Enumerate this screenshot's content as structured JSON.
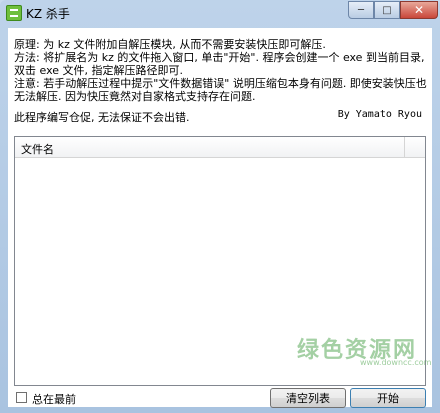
{
  "window": {
    "title": "KZ 杀手",
    "minimize": "─",
    "maximize": "□",
    "close": "✕"
  },
  "info": {
    "line1": "原理: 为 kz 文件附加自解压模块, 从而不需要安装快压即可解压.",
    "line2": "方法: 将扩展名为 kz 的文件拖入窗口, 单击\"开始\". 程序会创建一个 exe 到当前目录, 双击 exe 文件, 指定解压路径即可.",
    "line3": "注意: 若手动解压过程中提示\"文件数据错误\" 说明压缩包本身有问题. 即使安装快压也无法解压. 因为快压竟然对自家格式支持存在问题."
  },
  "note": {
    "left": "此程序编写仓促, 无法保证不会出错.",
    "right": "By Yamato Ryou"
  },
  "list": {
    "column_filename": "文件名",
    "rows": []
  },
  "options": {
    "topmost_label": "总在最前"
  },
  "buttons": {
    "clear_label": "清空列表",
    "start_label": "开始"
  },
  "watermark": {
    "text": "绿色资源网",
    "sub": "www.downcc.com"
  }
}
